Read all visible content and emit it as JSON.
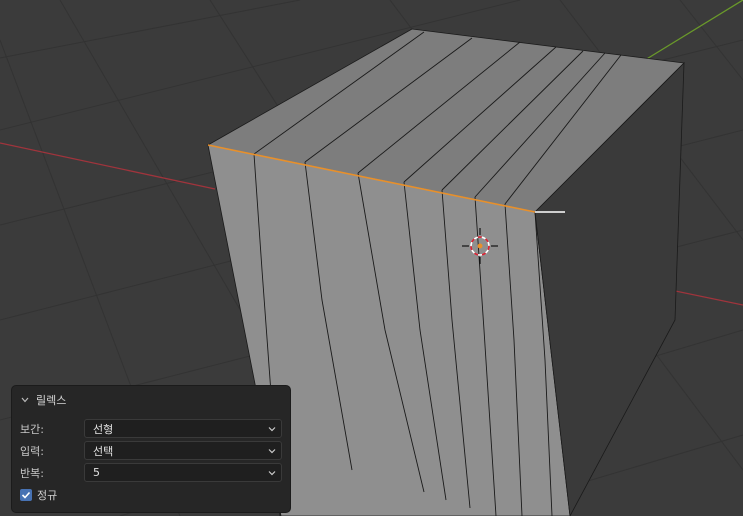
{
  "operator_panel": {
    "title": "릴렉스",
    "fields": [
      {
        "label": "보간:",
        "value": "선형"
      },
      {
        "label": "입력:",
        "value": "선택"
      },
      {
        "label": "반복:",
        "value": "5"
      }
    ],
    "normalize_label": "정규",
    "normalize_checked": true
  },
  "viewport": {
    "x_axis_color": "#a0343c",
    "y_axis_color": "#6a9a2a",
    "selected_edge_color": "#e8902b",
    "background_color": "#3b3b3b"
  }
}
